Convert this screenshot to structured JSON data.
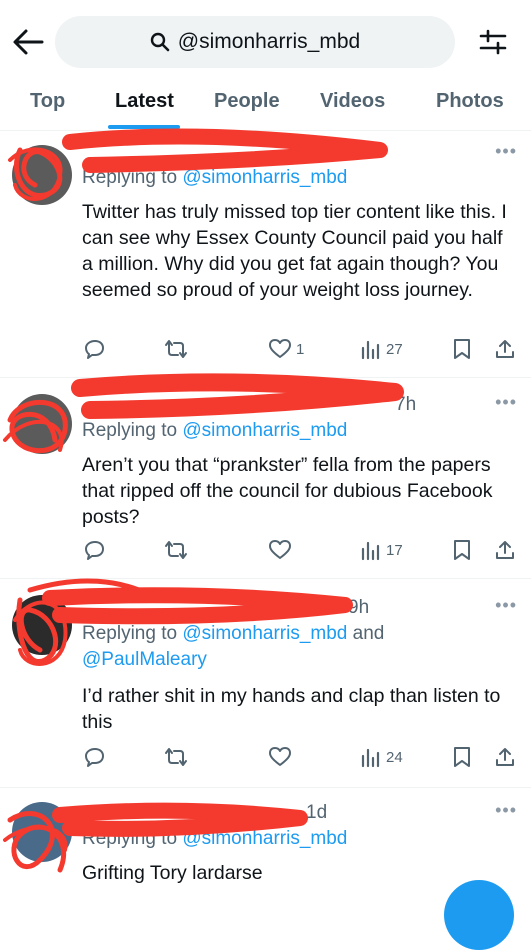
{
  "search": {
    "query": "@simonharris_mbd"
  },
  "tabs": [
    "Top",
    "Latest",
    "People",
    "Videos",
    "Photos"
  ],
  "active_tab": "Latest",
  "colors": {
    "accent": "#1d9bf0",
    "text": "#0f1419",
    "muted": "#536471",
    "redaction": "#f43a2e"
  },
  "tweets": [
    {
      "time": "",
      "reply_prefix": "Replying to ",
      "reply_to": "@simonharris_mbd",
      "reply_extra": "",
      "reply_extra2": "",
      "body": "Twitter has truly missed top tier content like this. I can see why Essex County Council paid you half a million. Why did you get fat again though? You seemed so proud of your weight loss journey.",
      "likes": "1",
      "views": "27"
    },
    {
      "time": "7h",
      "reply_prefix": "Replying to ",
      "reply_to": "@simonharris_mbd",
      "reply_extra": "",
      "reply_extra2": "",
      "body": "Aren’t you that “prankster” fella from the papers that ripped off the council for dubious Facebook posts?",
      "likes": "",
      "views": "17"
    },
    {
      "time": "9h",
      "reply_prefix": "Replying to ",
      "reply_to": "@simonharris_mbd",
      "reply_extra": " and",
      "reply_extra2": "@PaulMaleary",
      "body": "I’d rather shit in my hands and clap than listen to this",
      "likes": "",
      "views": "24"
    },
    {
      "time": "1d",
      "reply_prefix": "Replying to ",
      "reply_to": "@simonharris_mbd",
      "reply_extra": "",
      "reply_extra2": "",
      "body": "Grifting Tory lardarse",
      "likes": "",
      "views": ""
    }
  ]
}
